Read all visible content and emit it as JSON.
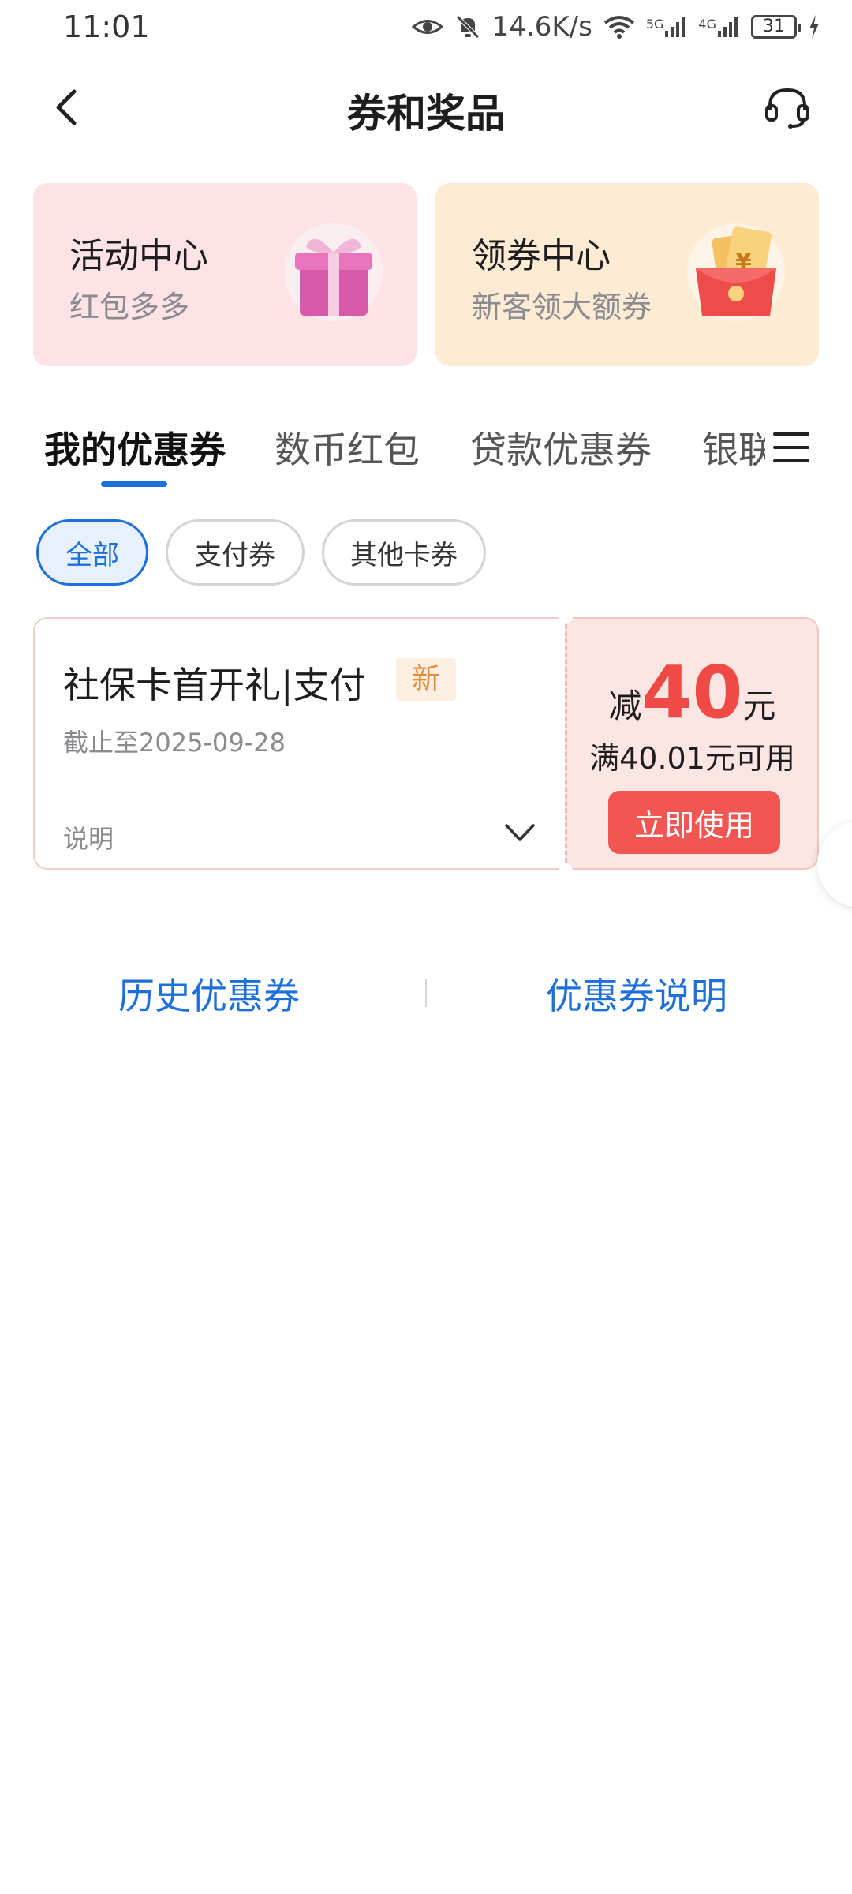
{
  "status_bar": {
    "time": "11:01",
    "net_speed": "14.6K/s",
    "signal_5g": "5G",
    "signal_4g": "4G",
    "battery": "31"
  },
  "header": {
    "title": "券和奖品"
  },
  "entry_cards": [
    {
      "title": "活动中心",
      "subtitle": "红包多多",
      "icon": "gift-box-icon",
      "bg": "#fde3e6"
    },
    {
      "title": "领券中心",
      "subtitle": "新客领大额券",
      "icon": "red-envelope-icon",
      "bg": "#fdebd4"
    }
  ],
  "tabs": [
    {
      "label": "我的优惠券",
      "active": true
    },
    {
      "label": "数币红包",
      "active": false
    },
    {
      "label": "贷款优惠券",
      "active": false
    },
    {
      "label": "银联",
      "active": false
    }
  ],
  "filters": [
    {
      "label": "全部",
      "active": true
    },
    {
      "label": "支付券",
      "active": false
    },
    {
      "label": "其他卡券",
      "active": false
    }
  ],
  "coupon": {
    "title": "社保卡首开礼|支付",
    "badge": "新",
    "deadline": "截止至2025-09-28",
    "desc_label": "说明",
    "amount_prefix": "减",
    "amount": "40",
    "amount_unit": "元",
    "condition": "满40.01元可用",
    "button": "立即使用"
  },
  "footer": {
    "history": "历史优惠券",
    "explain": "优惠券说明"
  },
  "colors": {
    "accent": "#1d6fdc",
    "red": "#ef4a45",
    "button_red": "#f25652",
    "badge_orange": "#e88a34"
  }
}
